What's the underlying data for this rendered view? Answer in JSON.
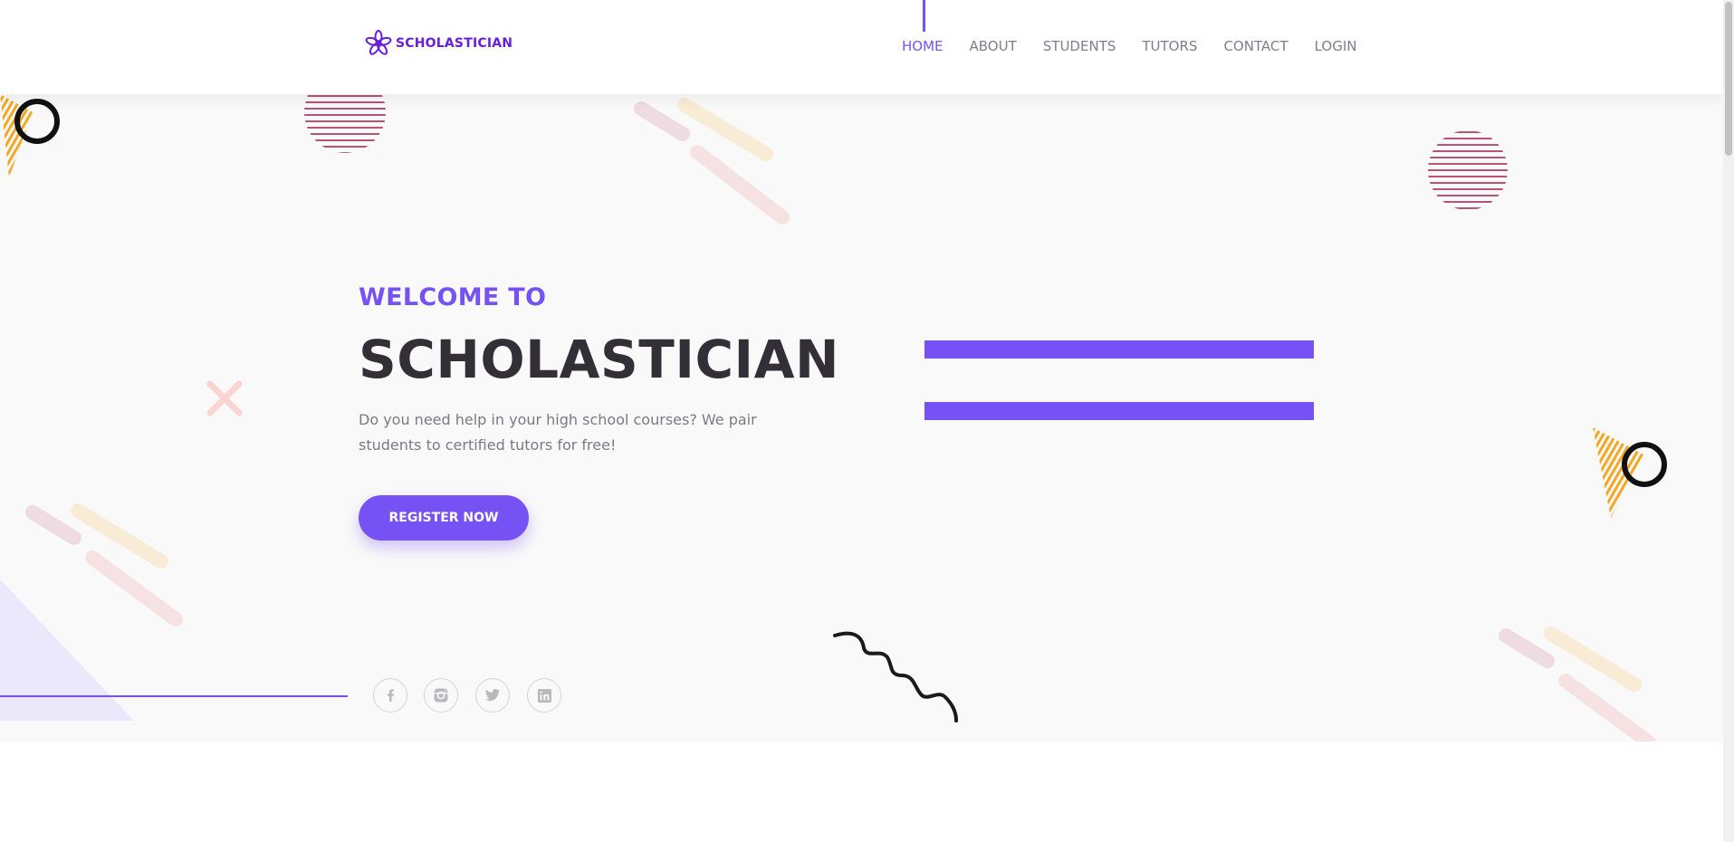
{
  "brand": {
    "logo_text": "SCHOLASTICIAN",
    "logo_icon": "flower-icon",
    "accent_color": "#7651f3"
  },
  "nav": {
    "items": [
      {
        "label": "HOME",
        "active": true
      },
      {
        "label": "ABOUT",
        "active": false
      },
      {
        "label": "STUDENTS",
        "active": false
      },
      {
        "label": "TUTORS",
        "active": false
      },
      {
        "label": "CONTACT",
        "active": false
      },
      {
        "label": "LOGIN",
        "active": false
      }
    ]
  },
  "hero": {
    "welcome": "WELCOME TO",
    "title": "SCHOLASTICIAN",
    "tagline": "Do you need help in your high school courses? We pair students to certified tutors for free!",
    "cta_label": "REGISTER NOW"
  },
  "social": [
    {
      "name": "facebook-icon"
    },
    {
      "name": "instagram-icon"
    },
    {
      "name": "twitter-icon"
    },
    {
      "name": "linkedin-icon"
    }
  ]
}
